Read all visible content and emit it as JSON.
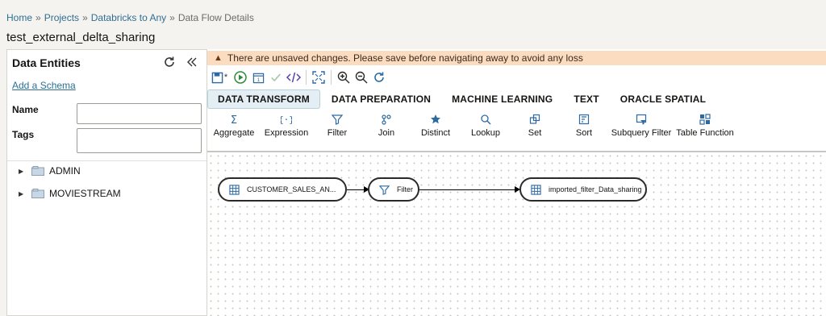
{
  "breadcrumb": {
    "home": "Home",
    "sep1": "»",
    "projects": "Projects",
    "sep2": "»",
    "project": "Databricks to Any",
    "sep3": "»",
    "current": "Data Flow Details"
  },
  "page_title": "test_external_delta_sharing",
  "left_panel": {
    "title": "Data Entities",
    "add_schema": "Add a Schema",
    "name_label": "Name",
    "name_value": "",
    "tags_label": "Tags",
    "tags_value": "",
    "tree": [
      {
        "label": "ADMIN"
      },
      {
        "label": "MOVIESTREAM"
      }
    ]
  },
  "warning": {
    "icon": "warning-icon",
    "text": "There are unsaved changes. Please save before navigating away to avoid any loss"
  },
  "toolbar": {
    "unsaved_marker": "*",
    "icons": [
      "save-icon",
      "run-icon",
      "schedule-icon",
      "validate-icon",
      "code-icon",
      "fit-icon",
      "zoom-in-icon",
      "zoom-out-icon",
      "refresh-icon"
    ]
  },
  "tabs": [
    "DATA TRANSFORM",
    "DATA PREPARATION",
    "MACHINE LEARNING",
    "TEXT",
    "ORACLE SPATIAL"
  ],
  "active_tab": "DATA TRANSFORM",
  "operators": [
    {
      "label": "Aggregate",
      "icon": "sigma-icon"
    },
    {
      "label": "Expression",
      "icon": "braces-icon"
    },
    {
      "label": "Filter",
      "icon": "funnel-icon"
    },
    {
      "label": "Join",
      "icon": "join-icon"
    },
    {
      "label": "Distinct",
      "icon": "star-icon"
    },
    {
      "label": "Lookup",
      "icon": "search-icon"
    },
    {
      "label": "Set",
      "icon": "set-icon"
    },
    {
      "label": "Sort",
      "icon": "sort-icon"
    },
    {
      "label": "Subquery Filter",
      "icon": "subquery-filter-icon"
    },
    {
      "label": "Table Function",
      "icon": "table-function-icon"
    }
  ],
  "flow": {
    "nodes": [
      {
        "label": "CUSTOMER_SALES_AN...",
        "icon": "table-icon"
      },
      {
        "label": "Filter",
        "icon": "funnel-icon"
      },
      {
        "label": "imported_filter_Data_sharing",
        "icon": "table-icon"
      }
    ]
  },
  "colors": {
    "accent": "#2b6f94",
    "warning_bg": "#fbdcc0",
    "run_green": "#2e8b3a",
    "icon_blue": "#2d6aa3"
  }
}
